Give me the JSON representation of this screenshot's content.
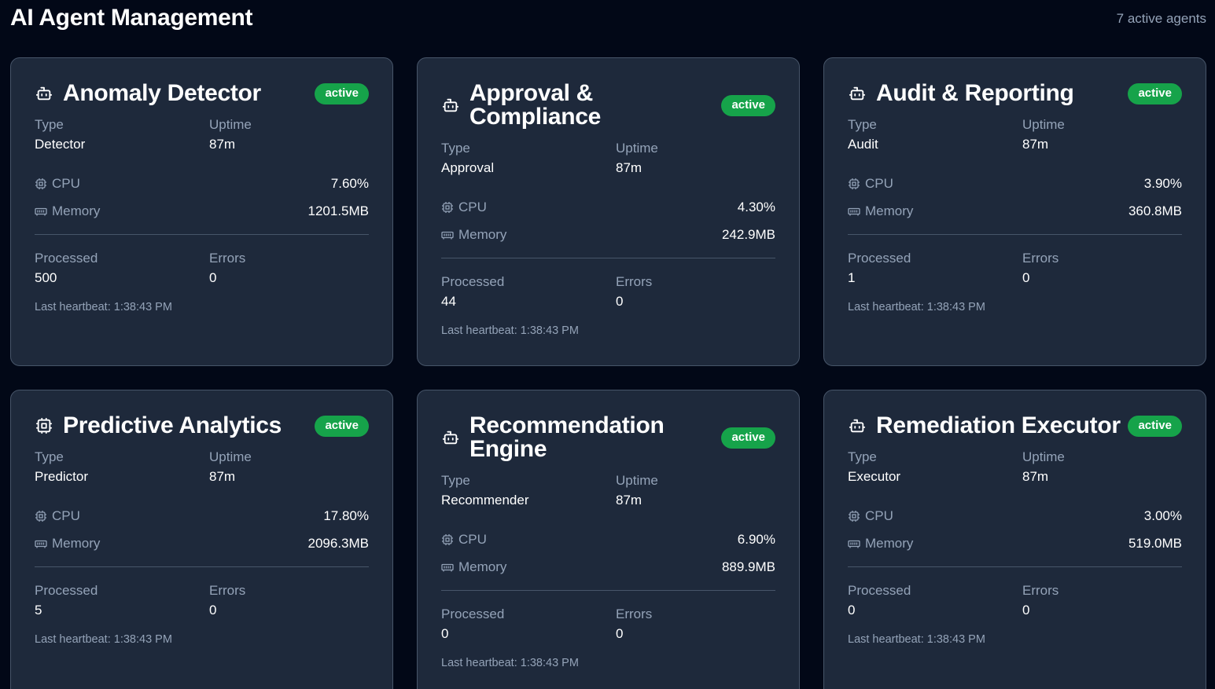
{
  "header": {
    "title": "AI Agent Management",
    "active_count": "7 active agents"
  },
  "labels": {
    "type": "Type",
    "uptime": "Uptime",
    "cpu": "CPU",
    "memory": "Memory",
    "processed": "Processed",
    "errors": "Errors"
  },
  "colors": {
    "background": "#020817",
    "card": "#1e293b",
    "card_border": "#475569",
    "badge_active": "#16a34a",
    "muted_text": "#94a3b8"
  },
  "agents": [
    {
      "name": "Anomaly Detector",
      "icon": "bot-icon",
      "status": "active",
      "type": "Detector",
      "uptime": "87m",
      "cpu": "7.60%",
      "memory": "1201.5MB",
      "processed": "500",
      "errors": "0",
      "heartbeat": "Last heartbeat: 1:38:43 PM"
    },
    {
      "name": "Approval & Compliance",
      "icon": "bot-icon",
      "status": "active",
      "type": "Approval",
      "uptime": "87m",
      "cpu": "4.30%",
      "memory": "242.9MB",
      "processed": "44",
      "errors": "0",
      "heartbeat": "Last heartbeat: 1:38:43 PM"
    },
    {
      "name": "Audit & Reporting",
      "icon": "bot-icon",
      "status": "active",
      "type": "Audit",
      "uptime": "87m",
      "cpu": "3.90%",
      "memory": "360.8MB",
      "processed": "1",
      "errors": "0",
      "heartbeat": "Last heartbeat: 1:38:43 PM"
    },
    {
      "name": "Predictive Analytics",
      "icon": "cpu-icon",
      "status": "active",
      "type": "Predictor",
      "uptime": "87m",
      "cpu": "17.80%",
      "memory": "2096.3MB",
      "processed": "5",
      "errors": "0",
      "heartbeat": "Last heartbeat: 1:38:43 PM"
    },
    {
      "name": "Recommendation Engine",
      "icon": "bot-icon",
      "status": "active",
      "type": "Recommender",
      "uptime": "87m",
      "cpu": "6.90%",
      "memory": "889.9MB",
      "processed": "0",
      "errors": "0",
      "heartbeat": "Last heartbeat: 1:38:43 PM"
    },
    {
      "name": "Remediation Executor",
      "icon": "bot-icon",
      "status": "active",
      "type": "Executor",
      "uptime": "87m",
      "cpu": "3.00%",
      "memory": "519.0MB",
      "processed": "0",
      "errors": "0",
      "heartbeat": "Last heartbeat: 1:38:43 PM"
    }
  ]
}
